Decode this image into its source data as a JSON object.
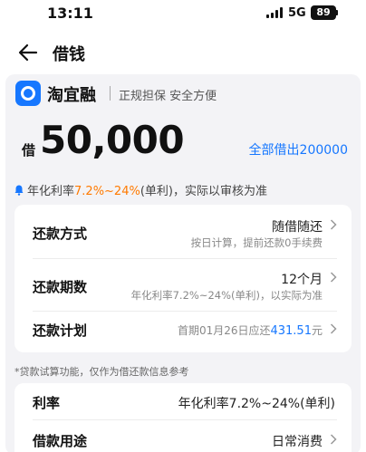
{
  "status_bar": {
    "time": "13:11",
    "network": "5G",
    "battery": "89",
    "icons": [
      "signal-icon",
      "battery-icon"
    ]
  },
  "nav": {
    "back_icon": "arrow-left-icon",
    "title": "借钱"
  },
  "brand": {
    "logo_icon": "taoyirong-logo-icon",
    "name": "淘宜融",
    "tagline": "正规担保 安全方便"
  },
  "loan": {
    "prefix": "借",
    "amount": "50,000",
    "borrow_all_label": "全部借出200000"
  },
  "rate_note": {
    "icon": "bell-icon",
    "prefix": "年化利率",
    "highlight": "7.2%~24%",
    "suffix": "(单利)，实际以审核为准"
  },
  "repayment": {
    "method": {
      "label": "还款方式",
      "value": "随借随还",
      "sub": "按日计算，提前还款0手续费"
    },
    "term": {
      "label": "还款期数",
      "value": "12个月",
      "sub": "年化利率7.2%~24%(单利)，以实际为准"
    },
    "plan": {
      "label": "还款计划",
      "prefix": "首期01月26日应还",
      "amount": "431.51",
      "suffix": "元"
    }
  },
  "disclaimer": "*贷款试算功能，仅作为借还款信息参考",
  "details": {
    "interest": {
      "label": "利率",
      "value": "年化利率7.2%~24%(单利)"
    },
    "purpose": {
      "label": "借款用途",
      "value": "日常消费"
    }
  },
  "colors": {
    "accent": "#1677ff",
    "highlight": "#ff7a00",
    "panel_bg": "#f3f3f6"
  }
}
